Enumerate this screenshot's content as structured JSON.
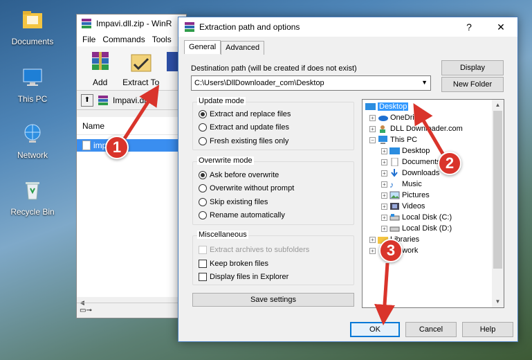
{
  "desktop": {
    "icons": [
      {
        "label": "Documents"
      },
      {
        "label": "This PC"
      },
      {
        "label": "Network"
      },
      {
        "label": "Recycle Bin"
      }
    ]
  },
  "winrar": {
    "title": "Impavi.dll.zip - WinR",
    "menu": [
      "File",
      "Commands",
      "Tools"
    ],
    "toolbar": {
      "add": "Add",
      "extract": "Extract To"
    },
    "path": "Impavi.dll.zi",
    "column_name": "Name",
    "selected_file": "impavi.dll"
  },
  "dialog": {
    "title": "Extraction path and options",
    "help_glyph": "?",
    "close_glyph": "✕",
    "tabs": [
      "General",
      "Advanced"
    ],
    "destination_label": "Destination path (will be created if does not exist)",
    "destination_value": "C:\\Users\\DllDownloader_com\\Desktop",
    "display_button": "Display",
    "new_folder_button": "New Folder",
    "update_mode": {
      "title": "Update mode",
      "options": [
        "Extract and replace files",
        "Extract and update files",
        "Fresh existing files only"
      ],
      "selected": 0
    },
    "overwrite_mode": {
      "title": "Overwrite mode",
      "options": [
        "Ask before overwrite",
        "Overwrite without prompt",
        "Skip existing files",
        "Rename automatically"
      ],
      "selected": 0
    },
    "misc": {
      "title": "Miscellaneous",
      "options": [
        "Extract archives to subfolders",
        "Keep broken files",
        "Display files in Explorer"
      ]
    },
    "save_settings": "Save settings",
    "tree": [
      {
        "label": "Desktop"
      },
      {
        "label": "OneDrive"
      },
      {
        "label": "DLL Downloader.com"
      },
      {
        "label": "This PC"
      },
      {
        "label": "Desktop"
      },
      {
        "label": "Documents"
      },
      {
        "label": "Downloads"
      },
      {
        "label": "Music"
      },
      {
        "label": "Pictures"
      },
      {
        "label": "Videos"
      },
      {
        "label": "Local Disk (C:)"
      },
      {
        "label": "Local Disk (D:)"
      },
      {
        "label": "Libraries"
      },
      {
        "label": "Network"
      }
    ],
    "buttons": {
      "ok": "OK",
      "cancel": "Cancel",
      "help": "Help"
    }
  },
  "markers": [
    "1",
    "2",
    "3"
  ],
  "colors": {
    "selection": "#3399ff",
    "marker": "#d9342b",
    "ok_border": "#0078d7"
  }
}
